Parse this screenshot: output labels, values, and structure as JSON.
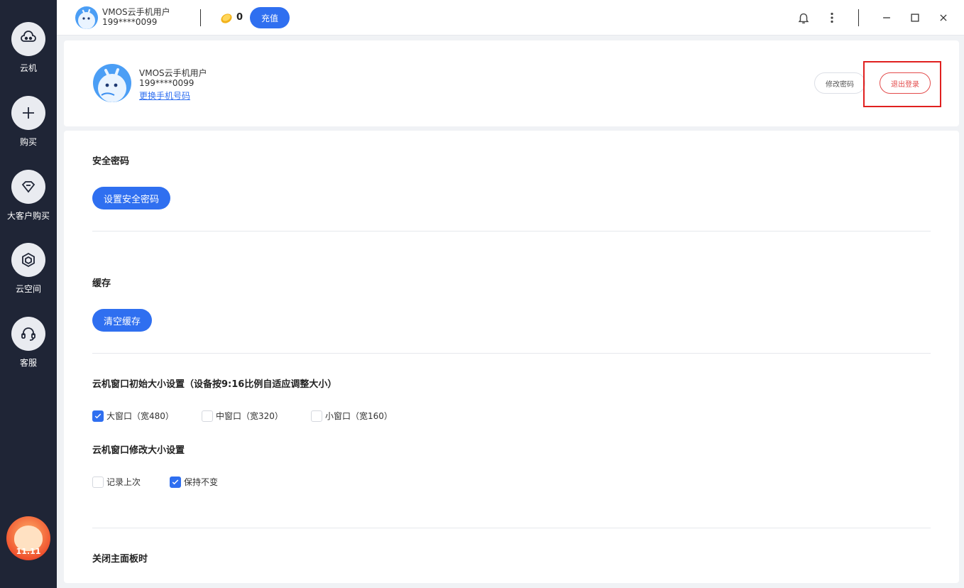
{
  "sidebar": {
    "items": [
      {
        "label": "云机",
        "icon": "cloud-phone-icon"
      },
      {
        "label": "购买",
        "icon": "plus-icon"
      },
      {
        "label": "大客户购买",
        "icon": "diamond-icon"
      },
      {
        "label": "云空间",
        "icon": "cube-icon"
      },
      {
        "label": "客服",
        "icon": "headset-icon"
      }
    ],
    "promo_text": "11.11"
  },
  "topbar": {
    "username": "VMOS云手机用户",
    "phone": "199****0099",
    "coin_count": "0",
    "recharge_label": "充值"
  },
  "profile": {
    "username": "VMOS云手机用户",
    "phone": "199****0099",
    "change_phone_link": "更换手机号码",
    "change_password_label": "修改密码",
    "logout_label": "退出登录"
  },
  "settings": {
    "security": {
      "title": "安全密码",
      "button": "设置安全密码"
    },
    "cache": {
      "title": "缓存",
      "button": "清空缓存"
    },
    "window_init": {
      "title": "云机窗口初始大小设置（设备按9:16比例自适应调整大小）",
      "options": [
        {
          "label": "大窗口（宽480）",
          "checked": true
        },
        {
          "label": "中窗口（宽320）",
          "checked": false
        },
        {
          "label": "小窗口（宽160）",
          "checked": false
        }
      ]
    },
    "window_resize": {
      "title": "云机窗口修改大小设置",
      "options": [
        {
          "label": "记录上次",
          "checked": false
        },
        {
          "label": "保持不变",
          "checked": true
        }
      ]
    },
    "close_panel": {
      "title": "关闭主面板时"
    }
  },
  "colors": {
    "accent": "#2f6ff0",
    "danger": "#e34b4b",
    "sidebar": "#1f2536"
  }
}
